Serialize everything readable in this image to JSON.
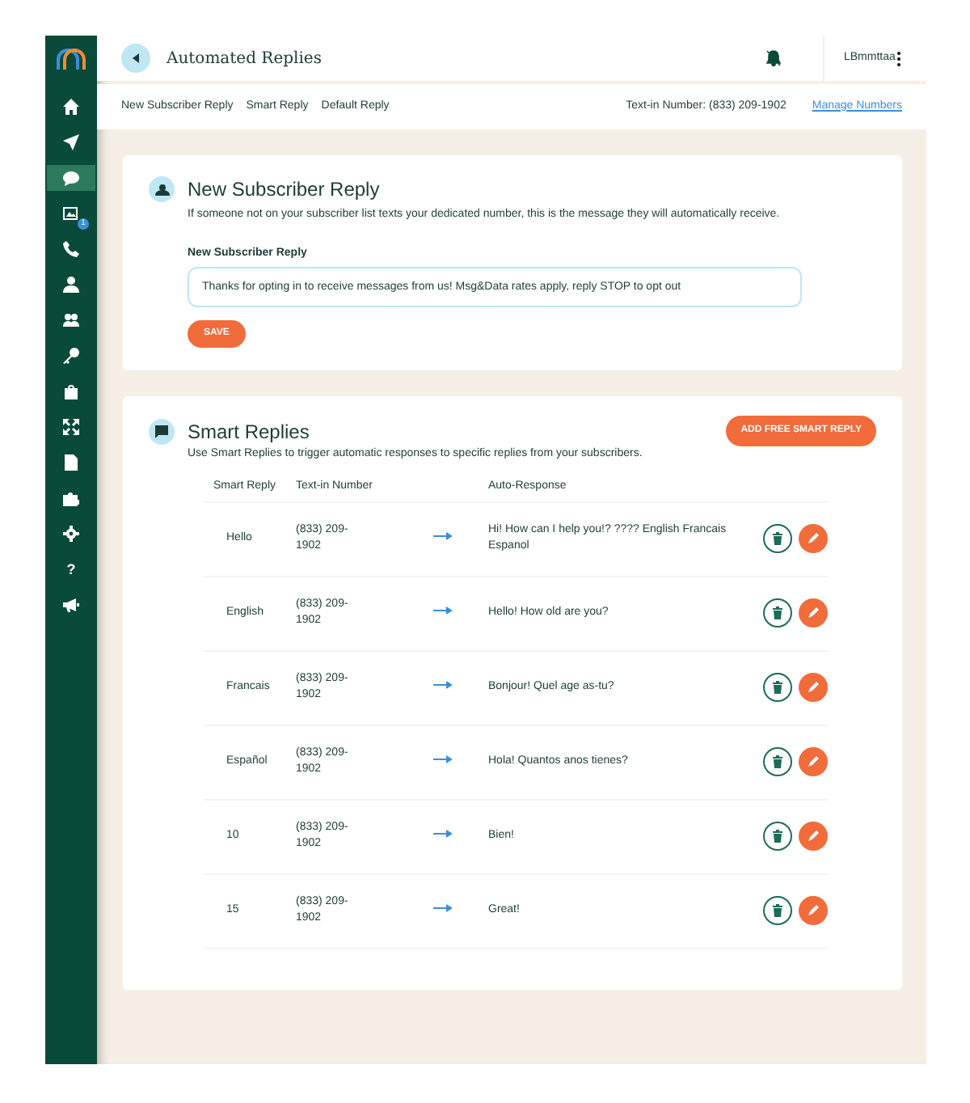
{
  "sidebar": {
    "items": [
      {
        "selected": false
      },
      {
        "selected": false
      },
      {
        "selected": true
      },
      {
        "selected": false,
        "badge": "1"
      },
      {
        "selected": false
      },
      {
        "selected": false
      },
      {
        "selected": false
      },
      {
        "selected": false
      },
      {
        "selected": false
      },
      {
        "selected": false
      },
      {
        "selected": false
      },
      {
        "selected": false
      },
      {
        "selected": false
      },
      {
        "selected": false,
        "label": "?"
      },
      {
        "selected": false
      }
    ]
  },
  "header": {
    "title": "Automated Replies",
    "user": "LBmmttaa"
  },
  "subnav": {
    "links": [
      "New Subscriber Reply",
      "Smart Reply",
      "Default Reply"
    ],
    "number_text": "Text-in Number: (833) 209-1902",
    "manage_link": "Manage Numbers"
  },
  "new_subscriber": {
    "title": "New Subscriber Reply",
    "description": "If someone not on your subscriber list texts your dedicated number, this is the message they will automatically receive.",
    "field_label": "New Subscriber Reply",
    "field_value": "Thanks for opting in to receive messages from us! Msg&Data rates apply, reply STOP to opt out",
    "save": "SAVE"
  },
  "smart_replies": {
    "title": "Smart Replies",
    "description": "Use Smart Replies to trigger automatic responses to specific replies from your subscribers.",
    "add_button": "ADD FREE SMART REPLY",
    "columns": [
      "Smart Reply",
      "Text-in Number",
      "Auto-Response"
    ],
    "rows": [
      {
        "reply": "Hello",
        "number": "(833) 209-1902",
        "response": "Hi! How can I help you!? ???? English Francais Espanol"
      },
      {
        "reply": "English",
        "number": "(833) 209-1902",
        "response": "Hello! How old are you?"
      },
      {
        "reply": "Francais",
        "number": "(833) 209-1902",
        "response": "Bonjour! Quel age as-tu?"
      },
      {
        "reply": "Español",
        "number": "(833) 209-1902",
        "response": "Hola! Quantos anos tienes?"
      },
      {
        "reply": "10",
        "number": "(833) 209-1902",
        "response": "Bien!"
      },
      {
        "reply": "15",
        "number": "(833) 209-1902",
        "response": "Great!"
      }
    ]
  }
}
